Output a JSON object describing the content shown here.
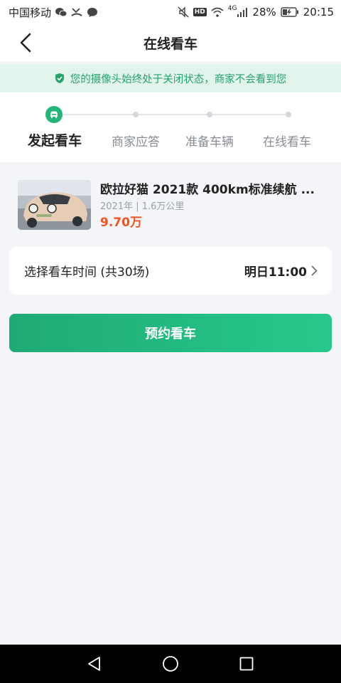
{
  "status_bar": {
    "carrier": "中国移动",
    "hd_badge": "HD",
    "network_type": "4G",
    "battery": "28%",
    "time": "20:15",
    "icons": [
      "wechat-icon",
      "missed-call-icon",
      "message-icon",
      "mute-icon",
      "wifi-icon",
      "signal-icon",
      "battery-icon"
    ]
  },
  "header": {
    "title": "在线看车",
    "back_icon": "chevron-left-icon"
  },
  "privacy_banner": {
    "text": "您的摄像头始终处于关闭状态，商家不会看到您",
    "icon": "shield-check-icon",
    "color": "#22a46c"
  },
  "steps": {
    "items": [
      {
        "label": "发起看车",
        "active": true
      },
      {
        "label": "商家应答",
        "active": false
      },
      {
        "label": "准备车辆",
        "active": false
      },
      {
        "label": "在线看车",
        "active": false
      }
    ],
    "active_color": "#22b779"
  },
  "car": {
    "title": "欧拉好猫 2021款 400km标准续航 ...",
    "meta": "2021年 | 1.6万公里",
    "price": "9.70万",
    "price_color": "#f0551f"
  },
  "time_select": {
    "label": "选择看车时间 (共30场)",
    "value": "明日11:00",
    "icon": "chevron-right-icon"
  },
  "reserve": {
    "label": "预约看车"
  },
  "nav_bar": {
    "icons": [
      "back-triangle-icon",
      "home-circle-icon",
      "recents-square-icon"
    ]
  }
}
